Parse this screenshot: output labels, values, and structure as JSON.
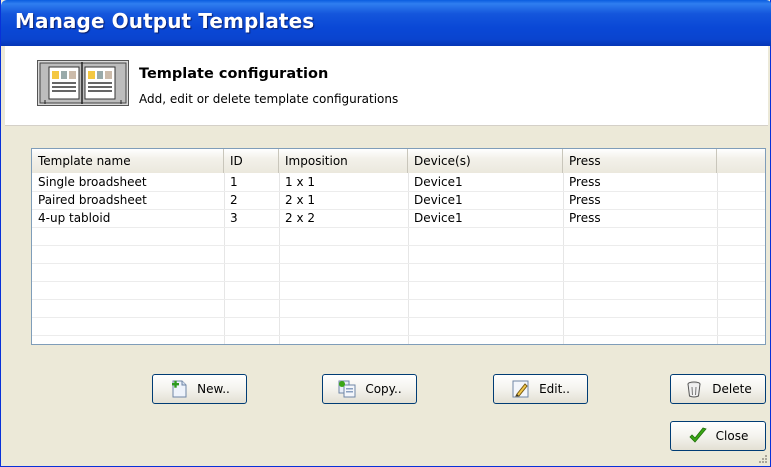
{
  "window": {
    "title": "Manage Output Templates"
  },
  "header": {
    "title": "Template configuration",
    "description": "Add, edit or delete template configurations"
  },
  "grid": {
    "columns": [
      "Template name",
      "ID",
      "Imposition",
      "Device(s)",
      "Press"
    ],
    "rows": [
      [
        "Single broadsheet",
        "1",
        "1 x 1",
        "Device1",
        "Press"
      ],
      [
        "Paired broadsheet",
        "2",
        "2 x 1",
        "Device1",
        "Press"
      ],
      [
        "4-up tabloid",
        "3",
        "2 x 2",
        "Device1",
        "Press"
      ]
    ]
  },
  "buttons": {
    "new": "New..",
    "copy": "Copy..",
    "edit": "Edit..",
    "delete": "Delete",
    "close": "Close"
  },
  "colors": {
    "titlebar": "#0a48d6",
    "accent_green": "#3aa614"
  }
}
